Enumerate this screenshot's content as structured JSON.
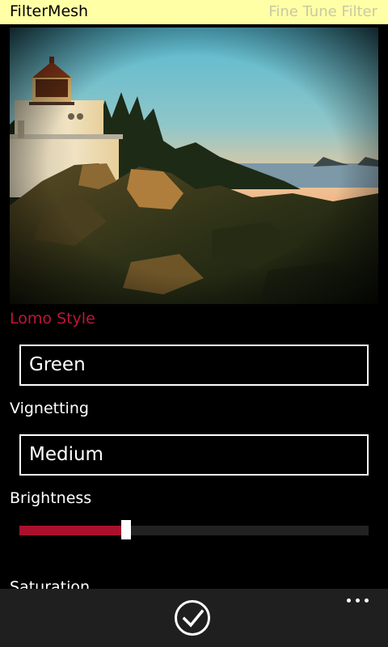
{
  "header": {
    "app_title": "FilterMesh",
    "page_title": "Fine Tune Filter"
  },
  "filter": {
    "style_label": "Lomo Style",
    "style_value": "Green",
    "vignetting_label": "Vignetting",
    "vignetting_value": "Medium",
    "brightness_label": "Brightness",
    "brightness_level": 0.305,
    "saturation_label": "Saturation"
  },
  "colors": {
    "accent": "#c0143a",
    "header_bg": "#ffffa6",
    "slider_fill": "#a9102e"
  },
  "appbar": {
    "accept_icon": "check-circle-icon",
    "more_icon": "ellipsis-icon"
  }
}
